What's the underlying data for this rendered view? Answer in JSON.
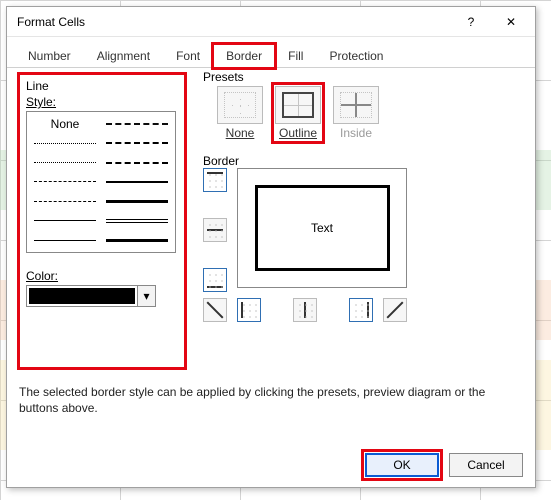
{
  "dialog": {
    "title": "Format Cells",
    "help_glyph": "?",
    "close_glyph": "✕"
  },
  "tabs": {
    "number": "Number",
    "alignment": "Alignment",
    "font": "Font",
    "border": "Border",
    "fill": "Fill",
    "protection": "Protection"
  },
  "line": {
    "group": "Line",
    "style": "Style:",
    "none": "None",
    "color": "Color:",
    "color_value": "#000000"
  },
  "presets": {
    "label": "Presets",
    "none": "None",
    "outline": "Outline",
    "inside": "Inside"
  },
  "border": {
    "label": "Border",
    "preview_text": "Text"
  },
  "hint": "The selected border style can be applied by clicking the presets, preview diagram or the buttons above.",
  "buttons": {
    "ok": "OK",
    "cancel": "Cancel"
  }
}
